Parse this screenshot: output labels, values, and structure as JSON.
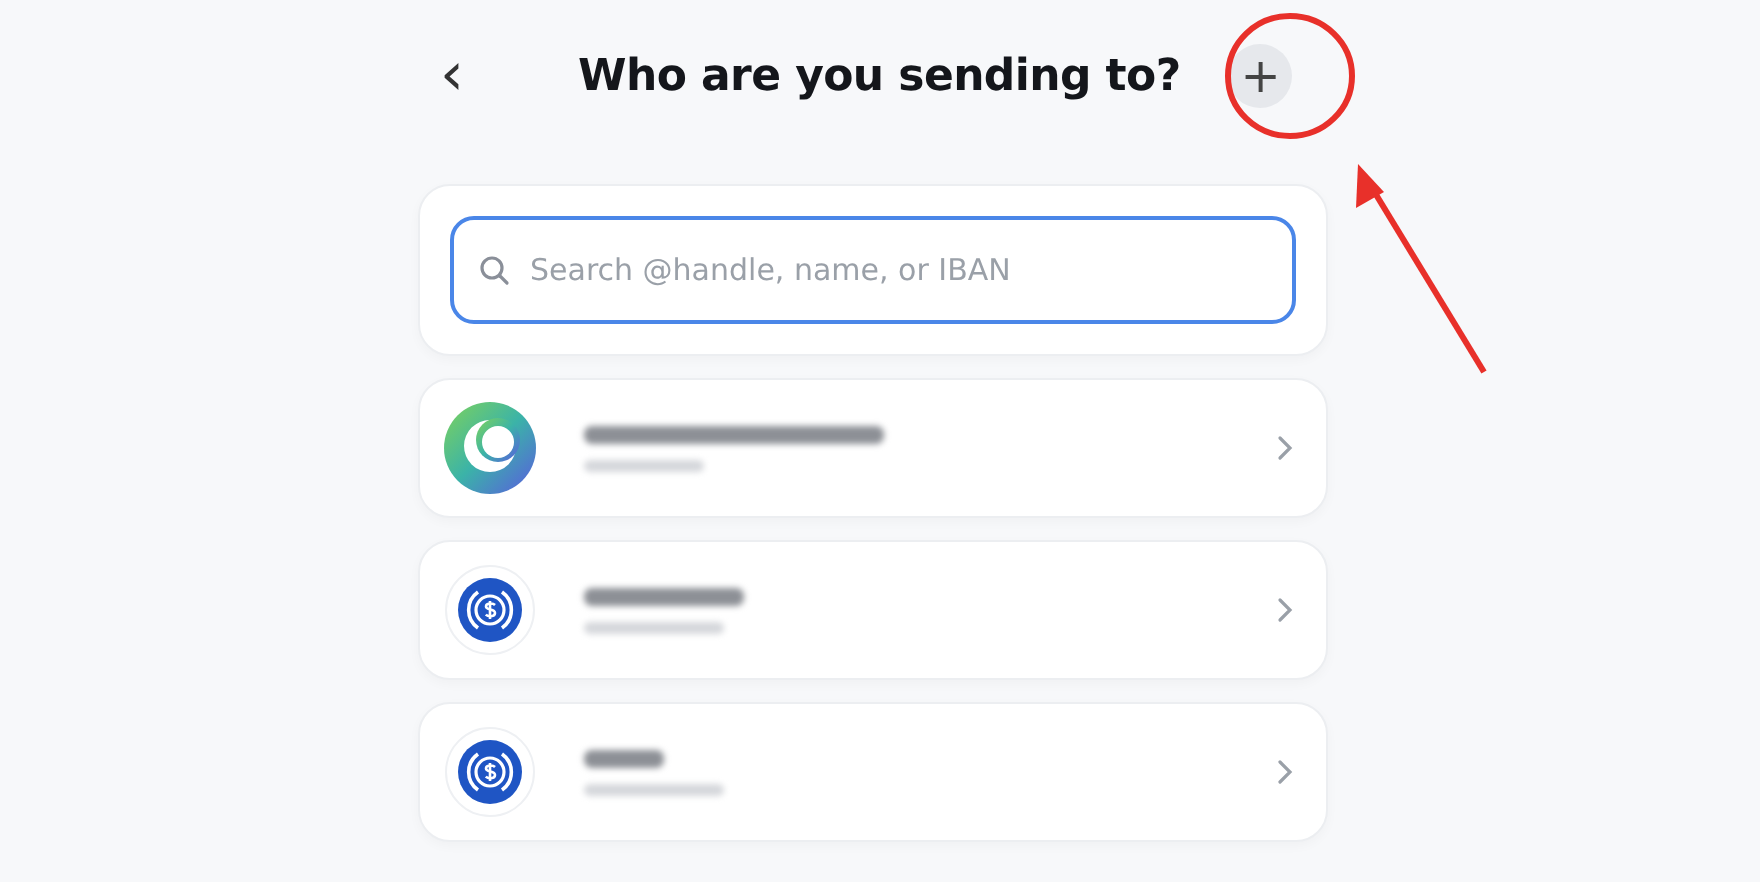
{
  "header": {
    "back": "‹",
    "title": "Who are you sending to?",
    "add": "+"
  },
  "search": {
    "placeholder": "Search @handle, name, or IBAN",
    "focused": true
  },
  "recipients": [
    {
      "kind": "gradient"
    },
    {
      "kind": "coin"
    },
    {
      "kind": "coin"
    }
  ],
  "annotation": {
    "kind": "circle-arrow"
  }
}
